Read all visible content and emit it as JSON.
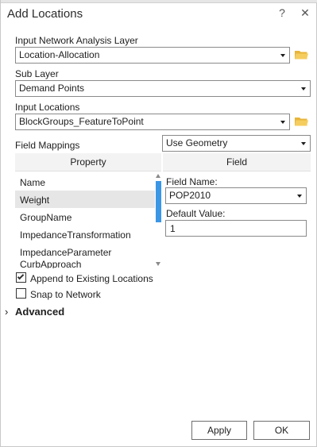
{
  "dialog": {
    "title": "Add Locations",
    "help_label": "?",
    "close_label": "✕"
  },
  "network_layer": {
    "label": "Input Network Analysis Layer",
    "value": "Location-Allocation"
  },
  "sub_layer": {
    "label": "Sub Layer",
    "value": "Demand Points"
  },
  "input_locations": {
    "label": "Input Locations",
    "value": "BlockGroups_FeatureToPoint"
  },
  "field_mappings": {
    "label": "Field Mappings",
    "value": "Use Geometry",
    "property_header": "Property",
    "field_header": "Field",
    "properties": [
      "Name",
      "Weight",
      "GroupName",
      "ImpedanceTransformation",
      "ImpedanceParameter",
      "CurbApproach"
    ],
    "selected_index": 1,
    "field_name_label": "Field Name:",
    "field_name_value": "POP2010",
    "default_value_label": "Default Value:",
    "default_value": "1"
  },
  "options": {
    "append_label": "Append to Existing Locations",
    "append_checked": true,
    "snap_label": "Snap to Network",
    "snap_checked": false
  },
  "advanced": {
    "chevron": "›",
    "label": "Advanced"
  },
  "buttons": {
    "apply": "Apply",
    "ok": "OK"
  },
  "colors": {
    "accent": "#3c96e6",
    "folder": "#e8b53a",
    "selection": "#e6e6e6"
  },
  "icons": [
    "folder-icon",
    "chevron-down-icon",
    "checkmark-icon",
    "help-icon",
    "close-icon"
  ]
}
